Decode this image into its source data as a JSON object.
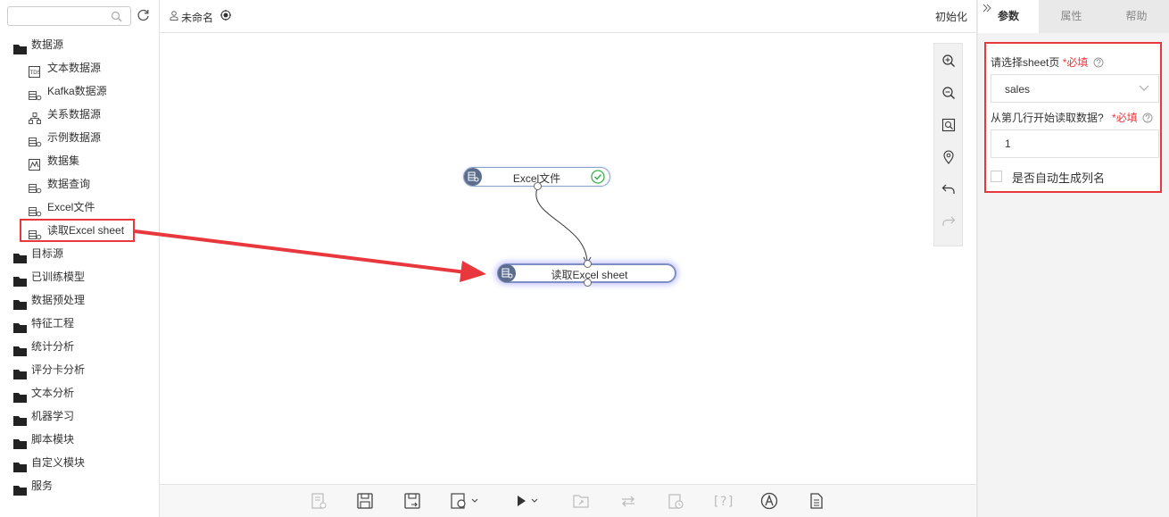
{
  "sidebar": {
    "search": {
      "placeholder": "",
      "value": ""
    },
    "tree": [
      {
        "type": "folder",
        "label": "数据源",
        "open": true
      },
      {
        "type": "child",
        "icon": "text-data-icon",
        "label": "文本数据源"
      },
      {
        "type": "child",
        "icon": "datasource-icon",
        "label": "Kafka数据源"
      },
      {
        "type": "child",
        "icon": "relation-icon",
        "label": "关系数据源"
      },
      {
        "type": "child",
        "icon": "datasource-icon",
        "label": "示例数据源"
      },
      {
        "type": "child",
        "icon": "dataset-icon",
        "label": "数据集"
      },
      {
        "type": "child",
        "icon": "datasource-icon",
        "label": "数据查询"
      },
      {
        "type": "child",
        "icon": "datasource-icon",
        "label": "Excel文件"
      },
      {
        "type": "child",
        "icon": "datasource-icon",
        "label": "读取Excel sheet"
      },
      {
        "type": "folder",
        "label": "目标源"
      },
      {
        "type": "folder",
        "label": "已训练模型"
      },
      {
        "type": "folder",
        "label": "数据预处理"
      },
      {
        "type": "folder",
        "label": "特征工程"
      },
      {
        "type": "folder",
        "label": "统计分析"
      },
      {
        "type": "folder",
        "label": "评分卡分析"
      },
      {
        "type": "folder",
        "label": "文本分析"
      },
      {
        "type": "folder",
        "label": "机器学习"
      },
      {
        "type": "folder",
        "label": "脚本模块"
      },
      {
        "type": "folder",
        "label": "自定义模块"
      },
      {
        "type": "folder",
        "label": "服务"
      }
    ]
  },
  "topbar": {
    "title": "未命名",
    "init_label": "初始化"
  },
  "canvas": {
    "nodes": [
      {
        "id": "excel-file",
        "label": "Excel文件",
        "status": "ok"
      },
      {
        "id": "read-sheet",
        "label": "读取Excel sheet",
        "status": "selected"
      }
    ]
  },
  "rightpanel": {
    "tabs": {
      "params": "参数",
      "props": "属性",
      "help": "帮助"
    },
    "fields": {
      "sheet_label": "请选择sheet页",
      "required_mark": "*必填",
      "sheet_value": "sales",
      "start_row_label": "从第几行开始读取数据?",
      "start_row_value": "1",
      "auto_col_label": "是否自动生成列名"
    }
  },
  "colors": {
    "highlight": "#e8383d",
    "node_icon": "#5b6c8c",
    "ok_green": "#3bb34a"
  }
}
